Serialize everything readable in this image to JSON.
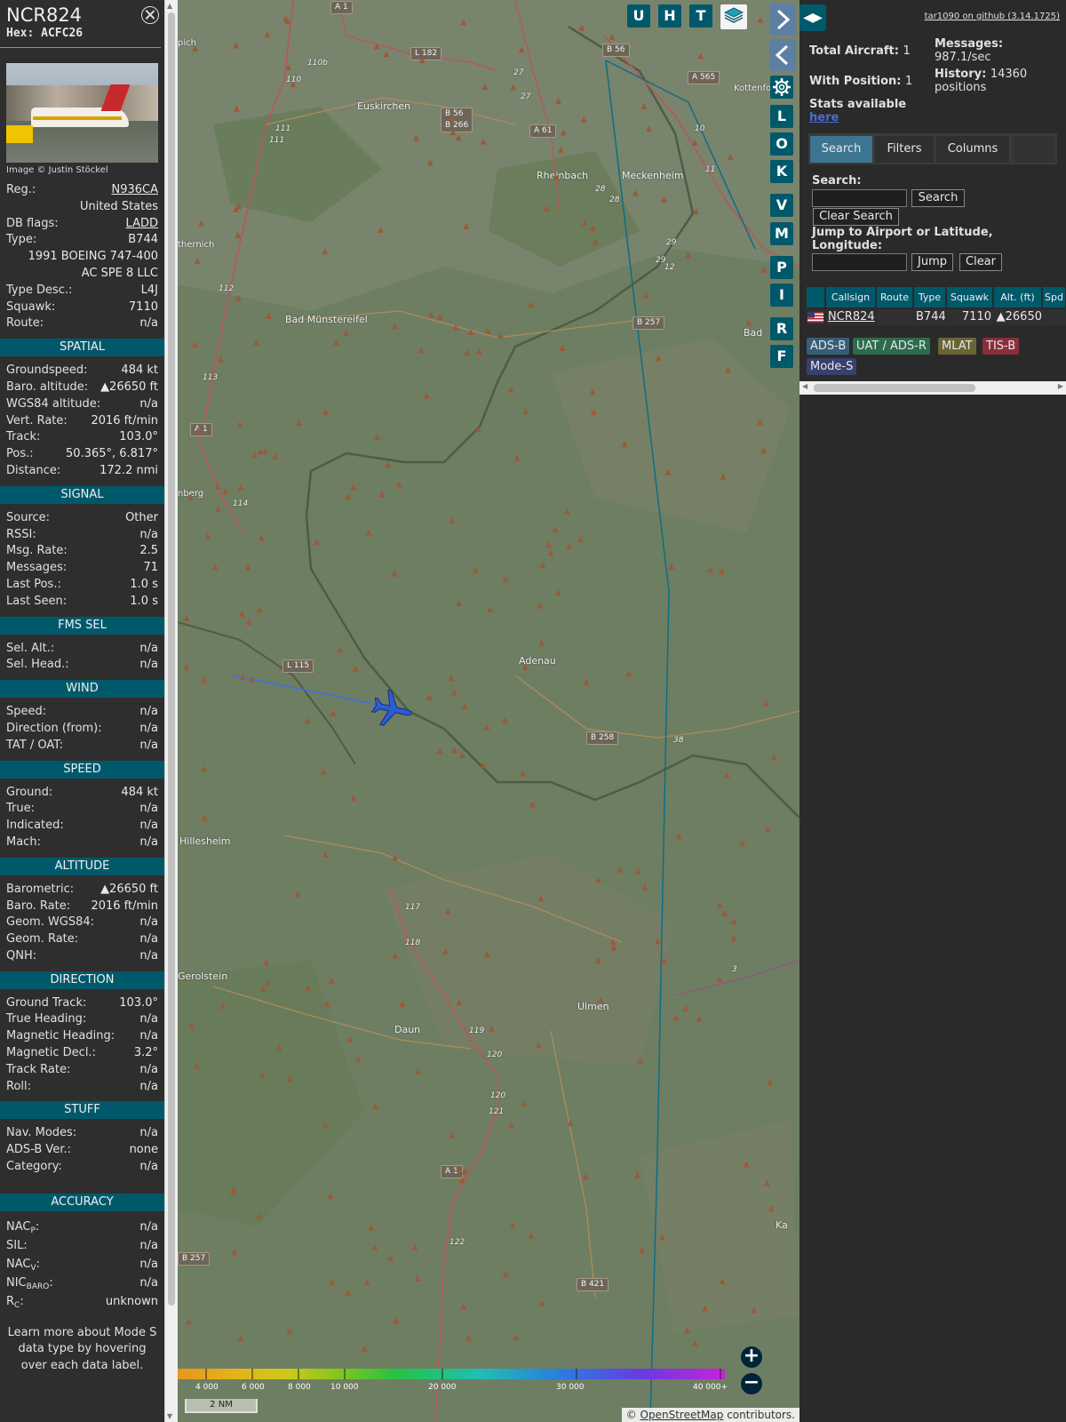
{
  "info": {
    "callsign": "NCR824",
    "hex": "Hex: ACFC26",
    "image_credit": "Image © Justin Stöckel",
    "reg_label": "Reg.:",
    "reg_value": "N936CA",
    "country": "United States",
    "dbflags_label": "DB flags:",
    "dbflags_value": "LADD",
    "type_label": "Type:",
    "type_value": "B744",
    "model": "1991 BOEING 747-400",
    "owner": "AC SPE 8 LLC",
    "typedesc_label": "Type Desc.:",
    "typedesc_value": "L4J",
    "squawk_label": "Squawk:",
    "squawk_value": "7110",
    "route_label": "Route:",
    "route_value": "n/a",
    "spatial": {
      "title": "SPATIAL",
      "rows": [
        {
          "label": "Groundspeed:",
          "value": "484 kt"
        },
        {
          "label": "Baro. altitude:",
          "value": "▲26650 ft"
        },
        {
          "label": "WGS84 altitude:",
          "value": "n/a"
        },
        {
          "label": "Vert. Rate:",
          "value": "2016 ft/min"
        },
        {
          "label": "Track:",
          "value": "103.0°"
        },
        {
          "label": "Pos.:",
          "value": "50.365°, 6.817°"
        },
        {
          "label": "Distance:",
          "value": "172.2 nmi"
        }
      ]
    },
    "signal": {
      "title": "SIGNAL",
      "rows": [
        {
          "label": "Source:",
          "value": "Other"
        },
        {
          "label": "RSSI:",
          "value": "n/a"
        },
        {
          "label": "Msg. Rate:",
          "value": "2.5"
        },
        {
          "label": "Messages:",
          "value": "71"
        },
        {
          "label": "Last Pos.:",
          "value": "1.0 s"
        },
        {
          "label": "Last Seen:",
          "value": "1.0 s"
        }
      ]
    },
    "fms": {
      "title": "FMS SEL",
      "rows": [
        {
          "label": "Sel. Alt.:",
          "value": "n/a"
        },
        {
          "label": "Sel. Head.:",
          "value": "n/a"
        }
      ]
    },
    "wind": {
      "title": "WIND",
      "rows": [
        {
          "label": "Speed:",
          "value": "n/a"
        },
        {
          "label": "Direction (from):",
          "value": "n/a"
        },
        {
          "label": "TAT / OAT:",
          "value": "n/a"
        }
      ]
    },
    "speed": {
      "title": "SPEED",
      "rows": [
        {
          "label": "Ground:",
          "value": "484 kt"
        },
        {
          "label": "True:",
          "value": "n/a"
        },
        {
          "label": "Indicated:",
          "value": "n/a"
        },
        {
          "label": "Mach:",
          "value": "n/a"
        }
      ]
    },
    "altitude": {
      "title": "ALTITUDE",
      "rows": [
        {
          "label": "Barometric:",
          "value": "▲26650 ft"
        },
        {
          "label": "Baro. Rate:",
          "value": "2016 ft/min"
        },
        {
          "label": "Geom. WGS84:",
          "value": "n/a"
        },
        {
          "label": "Geom. Rate:",
          "value": "n/a"
        },
        {
          "label": "QNH:",
          "value": "n/a"
        }
      ]
    },
    "direction": {
      "title": "DIRECTION",
      "rows": [
        {
          "label": "Ground Track:",
          "value": "103.0°"
        },
        {
          "label": "True Heading:",
          "value": "n/a"
        },
        {
          "label": "Magnetic Heading:",
          "value": "n/a"
        },
        {
          "label": "Magnetic Decl.:",
          "value": "3.2°"
        },
        {
          "label": "Track Rate:",
          "value": "n/a"
        },
        {
          "label": "Roll:",
          "value": "n/a"
        }
      ]
    },
    "stuff": {
      "title": "STUFF",
      "rows": [
        {
          "label": "Nav. Modes:",
          "value": "n/a"
        },
        {
          "label": "ADS-B Ver.:",
          "value": "none"
        },
        {
          "label": "Category:",
          "value": "n/a"
        }
      ]
    },
    "accuracy": {
      "title": "ACCURACY",
      "nacp": {
        "main": "NAC",
        "sub": "P",
        "value": "n/a"
      },
      "sil": {
        "label": "SIL:",
        "value": "n/a"
      },
      "nacv": {
        "main": "NAC",
        "sub": "V",
        "value": "n/a"
      },
      "nicbaro": {
        "main": "NIC",
        "sub": "BARO",
        "value": "n/a"
      },
      "rc": {
        "main": "R",
        "sub": "C",
        "value": "unknown"
      }
    },
    "note": "Learn more about Mode S data type by hovering over each data label."
  },
  "map": {
    "layer_buttons": [
      "U",
      "H",
      "T"
    ],
    "side_buttons": [
      "L",
      "O",
      "K",
      "V",
      "M",
      "P",
      "I",
      "R",
      "F"
    ],
    "labels": [
      "Euskirchen",
      "Rheinbach",
      "Meckenheim",
      "Bad Münstereifel",
      "Adenau",
      "Hillesheim",
      "Gerolstein",
      "Daun",
      "Ulmen",
      "Bad",
      "Ka",
      "pich",
      "thernich",
      "nberg",
      "Kottenforst"
    ],
    "road_badges": [
      "A 1",
      "L 182",
      "B 56",
      "A 565",
      "B 56\nB 266",
      "A 61",
      "B 257",
      "L 115",
      "A 1",
      "B 258",
      "A 1",
      "B 421",
      "B 257"
    ],
    "road_numbers": [
      "110b",
      "110",
      "111",
      "111",
      "112",
      "113",
      "114",
      "117",
      "118",
      "119",
      "120",
      "120",
      "121",
      "122",
      "27",
      "27",
      "28",
      "28",
      "29",
      "29",
      "10",
      "11",
      "12",
      "3",
      "38"
    ],
    "altitude_ticks": [
      "4 000",
      "6 000",
      "8 000",
      "10 000",
      "20 000",
      "30 000",
      "40 000+"
    ],
    "scale": "2 NM",
    "attribution_prefix": "© ",
    "attribution_link": "OpenStreetMap",
    "attribution_suffix": " contributors."
  },
  "side": {
    "github": "tar1090 on github (3.14.1725)",
    "total_label": "Total Aircraft:",
    "total_value": "1",
    "with_pos_label": "With Position:",
    "with_pos_value": "1",
    "messages_label": "Messages:",
    "messages_value": "987.1/sec",
    "history_label": "History:",
    "history_value": "14360",
    "history_unit": "positions",
    "stats_label": "Stats available",
    "stats_link": "here",
    "tabs": [
      "Search",
      "Filters",
      "Columns"
    ],
    "search_label": "Search:",
    "search_button": "Search",
    "clear_search_button": "Clear Search",
    "jump_label": "Jump to Airport or Latitude, Longitude:",
    "jump_button": "Jump",
    "clear_button": "Clear",
    "table": {
      "headers": [
        "",
        "Callsign",
        "Route",
        "Type",
        "Squawk",
        "Alt. (ft)",
        "Spd"
      ],
      "row": {
        "callsign": "NCR824",
        "route": "",
        "type": "B744",
        "squawk": "7110",
        "alt": "▲26650",
        "spd": ""
      }
    },
    "sources": [
      {
        "label": "ADS-B",
        "color": "#375e78"
      },
      {
        "label": "UAT / ADS-R",
        "color": "#2d6b4d"
      },
      {
        "label": "MLAT",
        "color": "#6b6536"
      },
      {
        "label": "TIS-B",
        "color": "#8a2f3a"
      },
      {
        "label": "Mode-S",
        "color": "#37406e"
      }
    ]
  }
}
